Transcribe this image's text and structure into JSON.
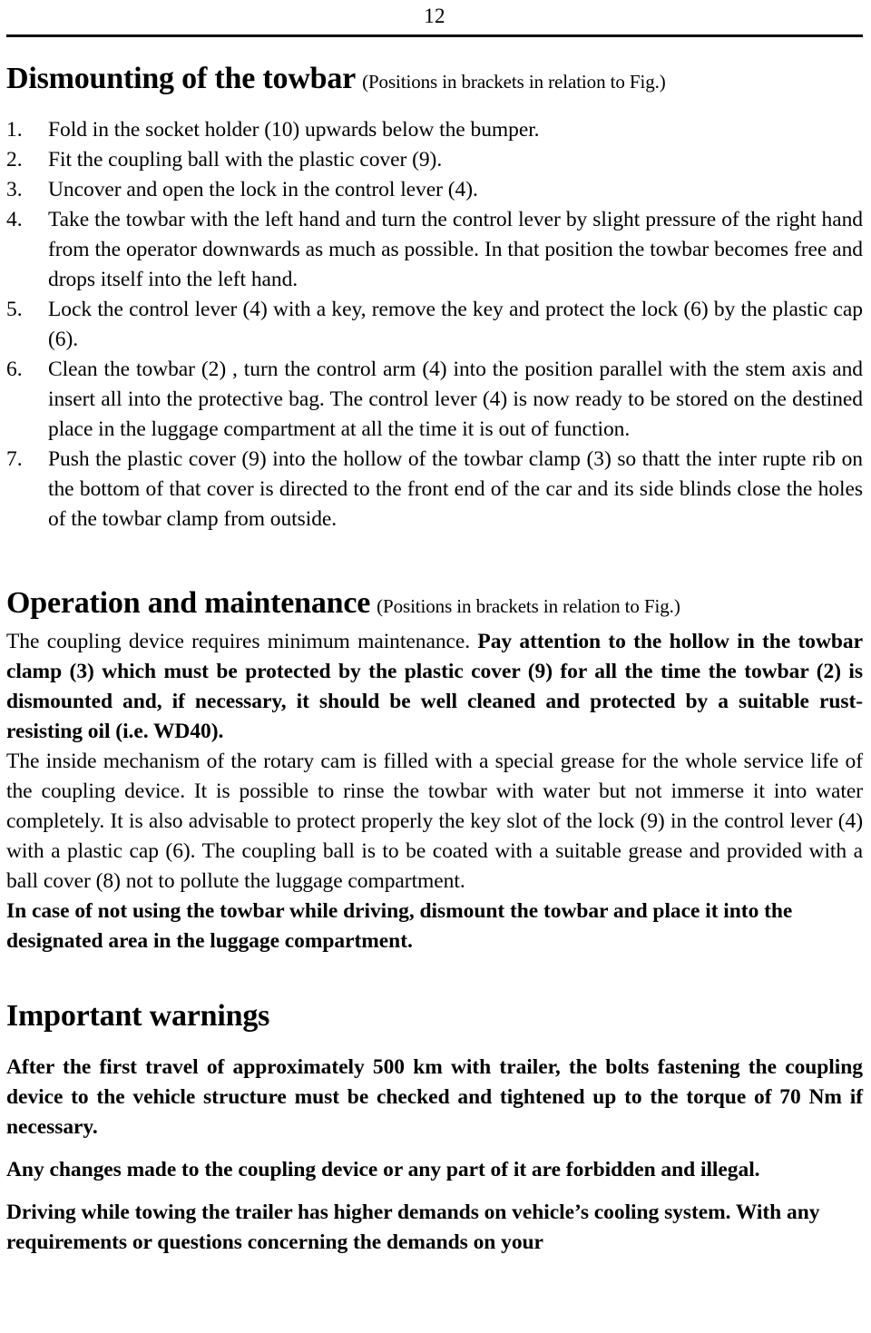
{
  "header": {
    "page_number": "12"
  },
  "sections": {
    "dismounting": {
      "heading": "Dismounting of the towbar",
      "heading_note": "(Positions in brackets in relation to Fig.)",
      "steps": [
        {
          "marker": "1.",
          "text": "Fold in the socket holder (10) upwards below the bumper."
        },
        {
          "marker": "2.",
          "text": "Fit the coupling ball  with the plastic cover (9)."
        },
        {
          "marker": "3.",
          "text": "Uncover and open the lock in the control lever (4)."
        },
        {
          "marker": "4.",
          "text": "Take the towbar with the left hand and turn the control lever by slight pressure of the right hand from the operator downwards as much as possible. In that position the towbar becomes free and drops itself into the left hand."
        },
        {
          "marker": "5.",
          "text": "Lock the control lever (4) with a key, remove the key and protect the lock (6) by the plastic cap (6)."
        },
        {
          "marker": "6.",
          "text": "Clean the towbar (2) , turn the control arm (4) into the position parallel with the stem axis and insert all into the protective bag. The control lever (4) is now ready to be stored on the destined place in the luggage compartment at all the time it is out of function."
        },
        {
          "marker": "7.",
          "text": "Push the plastic cover (9) into the hollow of the towbar clamp (3) so thatt the inter rupte rib on the bottom of that cover is directed to the front end of the car and its side blinds close the holes of the towbar clamp from outside."
        }
      ]
    },
    "operation": {
      "heading": "Operation and maintenance",
      "heading_note": "(Positions in brackets in relation to Fig.)",
      "paragraph_1_normal": "The coupling device requires minimum maintenance. ",
      "paragraph_1_bold": "Pay attention to the hollow in the towbar clamp (3) which must be protected by the plastic cover (9) for all the time the towbar (2) is dismounted and, if necessary, it should be well cleaned and protected by a suitable rust-resisting oil (i.e. WD40).",
      "paragraph_2": "The inside mechanism of the rotary cam is filled with a special grease for the whole service life of the coupling device. It is possible to rinse the towbar with water but not immerse it into water completely. It is also advisable to protect properly the key slot of the lock (9) in the control lever (4) with a plastic cap (6). The coupling ball is to be coated with a suitable grease and provided with a ball cover (8)  not to pollute the luggage compartment.",
      "paragraph_3_bold": "In case of not using the towbar while driving, dismount the towbar and place it into the designated area in the luggage compartment."
    },
    "warnings": {
      "heading": "Important warnings",
      "paragraph_1": "After the first travel of approximately 500 km with trailer, the bolts fastening the coupling device to the vehicle structure must be checked and tightened up to the torque of 70 Nm if necessary.",
      "paragraph_2": "Any changes made to the coupling device or any part of it are forbidden and illegal.",
      "paragraph_3": "Driving while towing the trailer has higher demands on vehicle’s cooling system. With any requirements or questions concerning the demands on your"
    }
  }
}
